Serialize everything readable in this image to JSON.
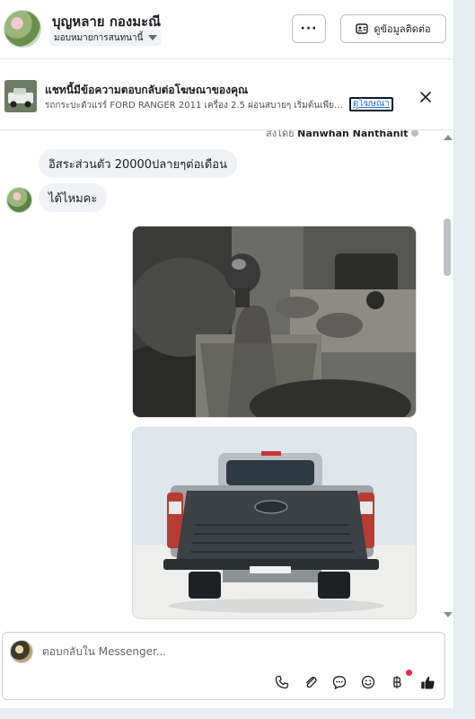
{
  "header": {
    "contact_name": "บุญหลาย กองมะณี",
    "assign_label": "มอบหมายการสนทนานี้",
    "more_label": "···",
    "view_contact_label": "ดูข้อมูลติดต่อ"
  },
  "ad_banner": {
    "title": "แชทนี้มีข้อความตอบกลับต่อโฆษณาของคุณ",
    "description": "รถกระบะตัวแรร์ FORD RANGER 2011 เครื่อง 2.5 ผ่อนสบายๆ เริ่มต้นเพียง...",
    "link_label": "ดูโฆษณา"
  },
  "conversation": {
    "sent_by_prefix": "ส่งโดย",
    "sent_by_name": "Nanwhan Nanthanit",
    "messages": [
      {
        "text": "อิสระส่วนตัว  20000ปลายๆต่อเดือน"
      },
      {
        "text": "ได้ไหมคะ"
      }
    ]
  },
  "composer": {
    "placeholder": "ตอบกลับใน Messenger..."
  },
  "colors": {
    "accent": "#216fdb",
    "notification": "#f0284a",
    "bubble": "#f0f2f5"
  }
}
